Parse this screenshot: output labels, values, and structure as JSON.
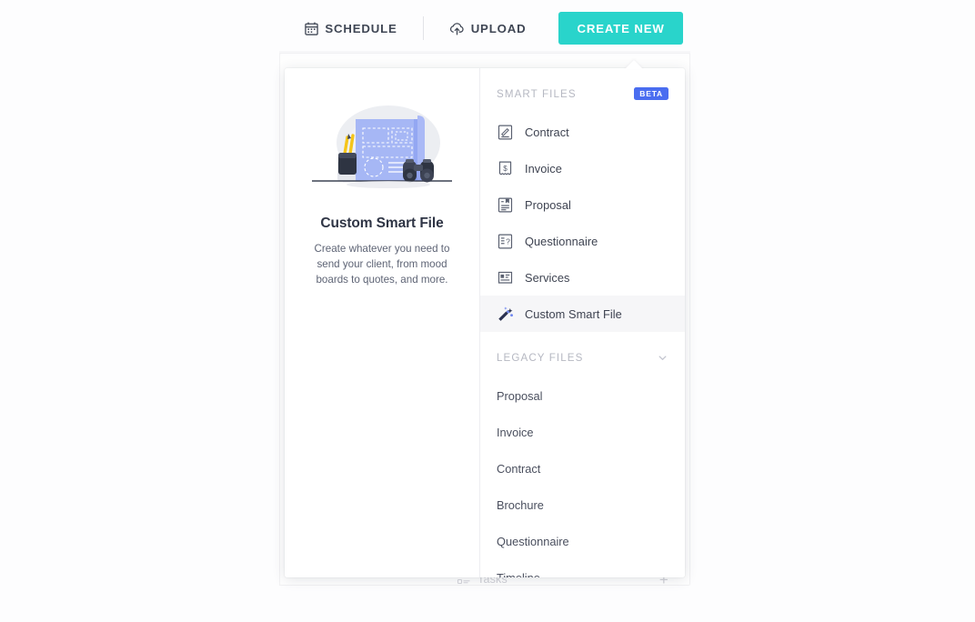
{
  "topbar": {
    "schedule": {
      "label": "SCHEDULE",
      "icon": "calendar-icon"
    },
    "upload": {
      "label": "UPLOAD",
      "icon": "cloud-upload-icon"
    },
    "create_new": {
      "label": "CREATE NEW",
      "color": "#29d4cb"
    }
  },
  "background": {
    "tasks_label": "Tasks",
    "add_symbol": "+"
  },
  "preview": {
    "title": "Custom Smart File",
    "description": "Create whatever you need to send your client, from mood boards to quotes, and more."
  },
  "dropdown": {
    "smart_files": {
      "header": "SMART FILES",
      "badge": "BETA",
      "badge_color": "#4a6df0",
      "items": [
        {
          "label": "Contract",
          "icon": "contract-signature-icon",
          "selected": false
        },
        {
          "label": "Invoice",
          "icon": "invoice-dollar-icon",
          "selected": false
        },
        {
          "label": "Proposal",
          "icon": "proposal-bookmark-icon",
          "selected": false
        },
        {
          "label": "Questionnaire",
          "icon": "questionnaire-question-icon",
          "selected": false
        },
        {
          "label": "Services",
          "icon": "services-list-icon",
          "selected": false
        },
        {
          "label": "Custom Smart File",
          "icon": "magic-wand-icon",
          "selected": true
        }
      ]
    },
    "legacy_files": {
      "header": "LEGACY FILES",
      "chevron": "chevron-down-icon",
      "items": [
        {
          "label": "Proposal"
        },
        {
          "label": "Invoice"
        },
        {
          "label": "Contract"
        },
        {
          "label": "Brochure"
        },
        {
          "label": "Questionnaire"
        },
        {
          "label": "Timeline"
        }
      ]
    }
  }
}
